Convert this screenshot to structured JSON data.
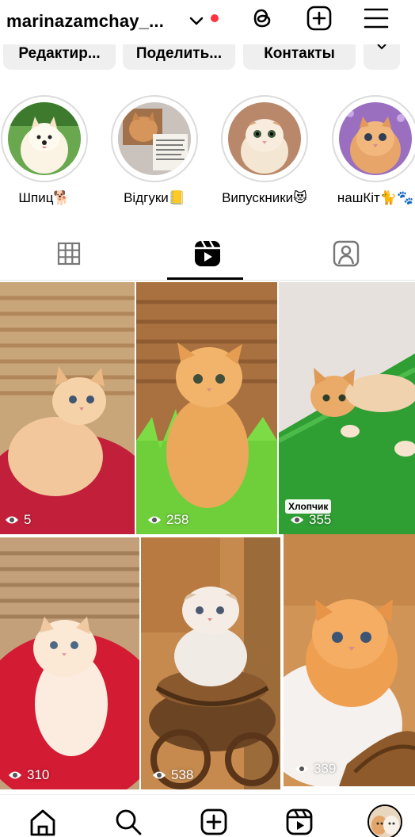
{
  "header": {
    "username": "marinazamchay_..."
  },
  "actions": {
    "edit_label": "Редактир...",
    "share_label": "Поделить...",
    "contacts_label": "Контакты"
  },
  "highlights": [
    {
      "label": "Шпиц🐕"
    },
    {
      "label": "Відгуки📒"
    },
    {
      "label": "Випускники😻"
    },
    {
      "label": "нашКіт🐈🐾"
    }
  ],
  "grid": {
    "items": [
      {
        "views": "5"
      },
      {
        "views": "258"
      },
      {
        "views": "355",
        "tag": "Хлопчик"
      },
      {
        "views": "310"
      },
      {
        "views": "538"
      },
      {
        "views": "339"
      }
    ]
  },
  "icons": {
    "dropdown": "chevron-down-icon",
    "threads": "threads-icon",
    "create": "plus-square-icon",
    "menu": "hamburger-menu-icon",
    "grid_tab": "grid-icon",
    "reels_tab": "reels-icon",
    "tagged_tab": "tagged-person-icon",
    "views": "eye-icon",
    "nav_home": "home-icon",
    "nav_search": "search-icon",
    "nav_create": "plus-square-icon",
    "nav_reels": "reels-icon",
    "nav_profile": "profile-avatar"
  },
  "colors": {
    "notification_dot": "#ff3040",
    "button_bg": "#efefef",
    "ring": "#dbdbdb"
  }
}
